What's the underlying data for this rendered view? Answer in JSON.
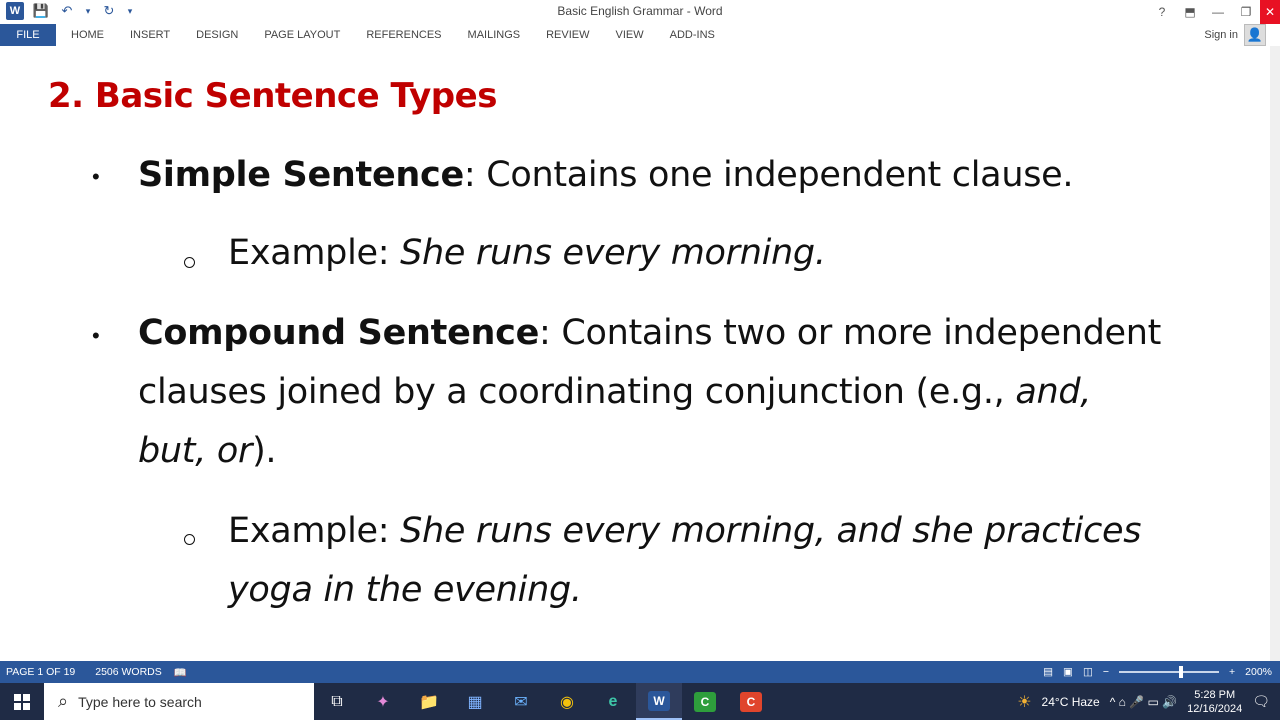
{
  "window": {
    "title": "Basic English Grammar - Word",
    "help_glyph": "?",
    "restore_ribbon_glyph": "⬒",
    "minimize_glyph": "—",
    "restore_glyph": "❐",
    "close_glyph": "✕"
  },
  "quick_access": {
    "app_glyph": "W",
    "save_glyph": "💾",
    "undo_glyph": "↶",
    "undo_dropdown_glyph": "▾",
    "redo_glyph": "↻",
    "customize_glyph": "▾"
  },
  "ribbon": {
    "file_label": "FILE",
    "tabs": [
      "HOME",
      "INSERT",
      "DESIGN",
      "PAGE LAYOUT",
      "REFERENCES",
      "MAILINGS",
      "REVIEW",
      "VIEW",
      "ADD-INS"
    ],
    "sign_in": "Sign in",
    "avatar_glyph": "👤"
  },
  "document": {
    "heading": "2. Basic Sentence Types",
    "bullet_glyph": "•",
    "items": [
      {
        "term": "Simple Sentence",
        "definition": ": Contains one independent clause.",
        "example_label": "Example: ",
        "example_text": "She runs every morning."
      },
      {
        "term": "Compound Sentence",
        "definition_line1": ": Contains two or more independent",
        "definition_line2": "clauses joined by a coordinating conjunction (e.g., ",
        "definition_italic_a": "and,",
        "definition_italic_b": "but, or",
        "definition_tail": ").",
        "example_label": "Example: ",
        "example_text_line1": "She runs every morning, and she practices",
        "example_text_line2": "yoga in the evening."
      }
    ]
  },
  "status_bar": {
    "page": "PAGE 1 OF 19",
    "words": "2506 WORDS",
    "proofing_glyph": "📖",
    "zoom_minus": "−",
    "zoom_plus": "+",
    "zoom_level": "200%",
    "zoom_fraction": 0.62
  },
  "taskbar": {
    "search_placeholder": "Type here to search",
    "search_glyph": "⌕",
    "weather_glyph": "☀",
    "weather": "24°C  Haze",
    "tray_glyphs": "^  ⌂  🎤  ▭  🔊",
    "time": "5:28 PM",
    "date": "12/16/2024",
    "notification_glyph": "🗨",
    "apps": [
      {
        "glyph": "⧉"
      },
      {
        "glyph": "✦"
      },
      {
        "glyph": "📁"
      },
      {
        "glyph": "▦"
      },
      {
        "glyph": "✉"
      },
      {
        "glyph": "◉"
      },
      {
        "glyph": "e"
      },
      {
        "glyph": "W"
      },
      {
        "glyph": "C"
      },
      {
        "glyph": "C"
      }
    ]
  },
  "colors": {
    "accent": "#2b579a",
    "heading": "#c00000",
    "taskbar": "#1f2b45"
  }
}
